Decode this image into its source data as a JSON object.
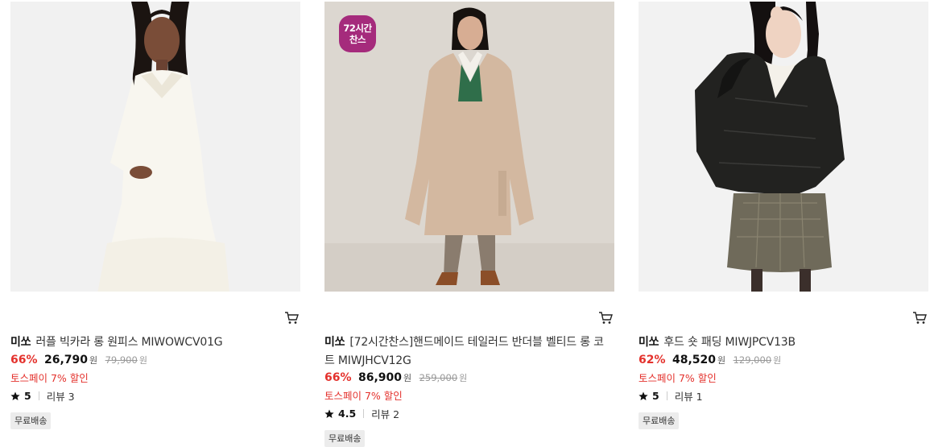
{
  "products": [
    {
      "brand": "미쏘",
      "name": "러플 빅카라 롱 원피스 MIWOWCV01G",
      "discount": "66%",
      "price": "26,790",
      "currency": "원",
      "original_price": "79,900",
      "original_currency": "원",
      "promo": "토스페이 7% 할인",
      "rating": "5",
      "reviews": "리뷰 3",
      "shipping": "무료배송",
      "badge": null,
      "image_icon": "model-white-dress-photo",
      "cart_icon": "cart-icon"
    },
    {
      "brand": "미쏘",
      "name": "[72시간찬스]핸드메이드 테일러드 반더블 벨티드 롱 코트 MIWJHCV12G",
      "discount": "66%",
      "price": "86,900",
      "currency": "원",
      "original_price": "259,000",
      "original_currency": "원",
      "promo": "토스페이 7% 할인",
      "rating": "4.5",
      "reviews": "리뷰 2",
      "shipping": "무료배송",
      "badge": {
        "line1": "72시간",
        "line2": "찬스",
        "color": "#a52b7c"
      },
      "image_icon": "model-beige-coat-photo",
      "cart_icon": "cart-icon"
    },
    {
      "brand": "미쏘",
      "name": "후드 숏 패딩 MIWJPCV13B",
      "discount": "62%",
      "price": "48,520",
      "currency": "원",
      "original_price": "129,000",
      "original_currency": "원",
      "promo": "토스페이 7% 할인",
      "rating": "5",
      "reviews": "리뷰 1",
      "shipping": "무료배송",
      "badge": null,
      "image_icon": "model-black-padding-photo",
      "cart_icon": "cart-icon"
    }
  ],
  "colors": {
    "discount": "#e4322d",
    "badge": "#a52b7c",
    "shipping_bg": "#ececec"
  }
}
